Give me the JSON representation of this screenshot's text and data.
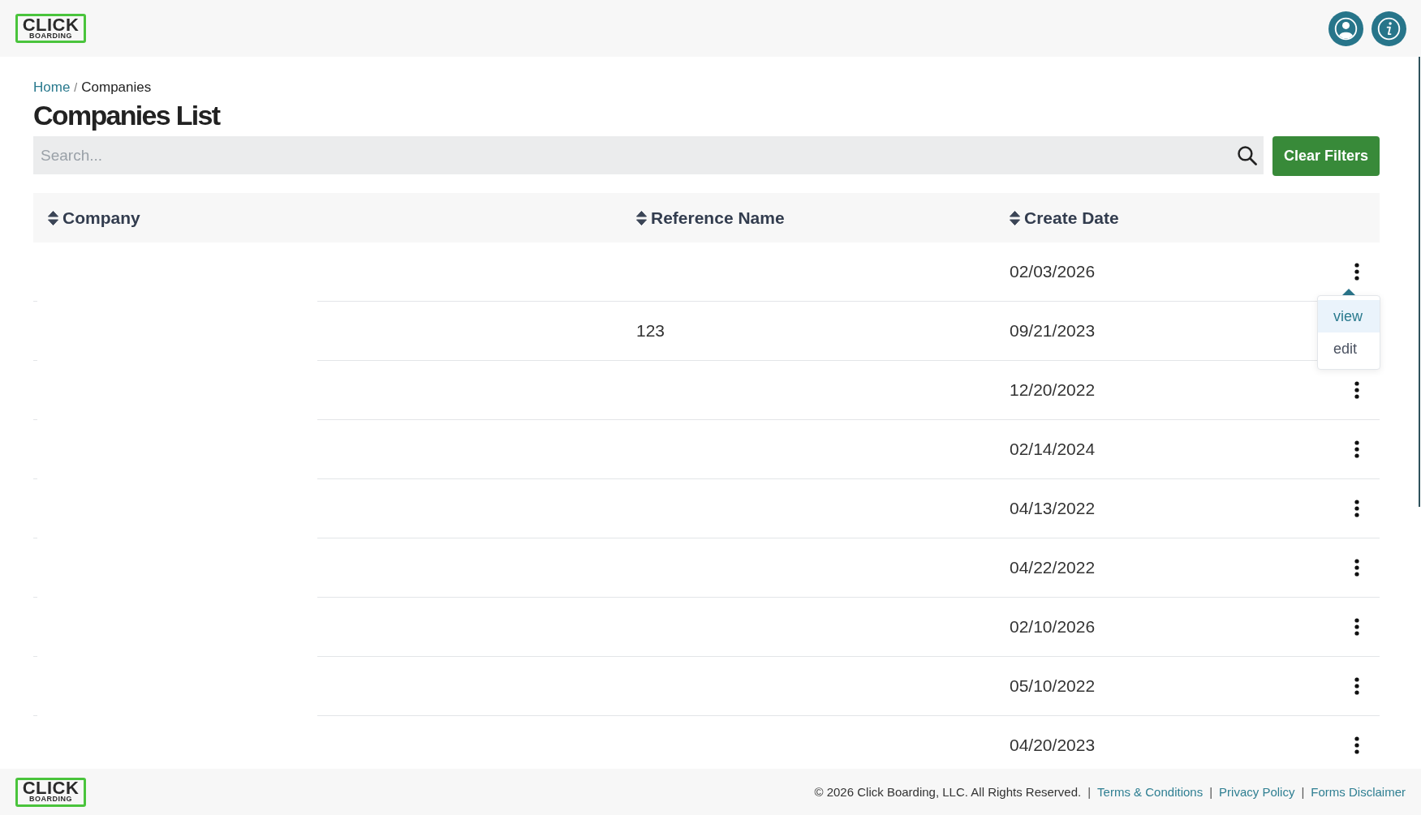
{
  "header": {
    "logo": {
      "wordmark": "CLICK",
      "tagline": "BOARDING"
    }
  },
  "breadcrumb": [
    {
      "kind": "link",
      "label": "Home"
    },
    {
      "kind": "separator",
      "label": "/"
    },
    {
      "kind": "current",
      "label": "Companies"
    }
  ],
  "page_title": "Companies List",
  "search": {
    "placeholder": "Search..."
  },
  "clear_filters_button": {
    "label": "Clear Filters"
  },
  "table": {
    "columns": [
      {
        "label": "Company"
      },
      {
        "label": "Reference Name"
      },
      {
        "label": "Create Date"
      }
    ],
    "rows": [
      {
        "create_date": "02/03/2026",
        "menu": {
          "items": [
            {
              "label": "view",
              "highlighted": true
            },
            {
              "label": "edit",
              "highlighted": false
            }
          ]
        }
      },
      {
        "reference_name": "123",
        "create_date": "09/21/2023"
      },
      {
        "create_date": "12/20/2022"
      },
      {
        "create_date": "02/14/2024"
      },
      {
        "create_date": "04/13/2022"
      },
      {
        "create_date": "04/22/2022"
      },
      {
        "create_date": "02/10/2026"
      },
      {
        "create_date": "05/10/2022"
      },
      {
        "create_date": "04/20/2023"
      }
    ]
  },
  "footer": {
    "logo": {
      "wordmark": "CLICK",
      "tagline": "BOARDING"
    },
    "items": [
      {
        "kind": "text",
        "label": "© 2026 Click Boarding, LLC. All Rights Reserved."
      },
      {
        "kind": "separator",
        "label": "|"
      },
      {
        "kind": "link",
        "label": "Terms & Conditions"
      },
      {
        "kind": "separator",
        "label": "|"
      },
      {
        "kind": "link",
        "label": "Privacy Policy"
      },
      {
        "kind": "separator",
        "label": "|"
      },
      {
        "kind": "link",
        "label": "Forms Disclaimer"
      }
    ]
  }
}
